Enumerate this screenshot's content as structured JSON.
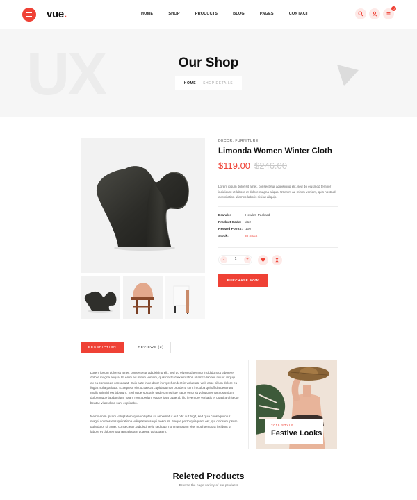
{
  "header": {
    "logo_text": "vue",
    "logo_dot": ".",
    "nav": [
      "HOME",
      "SHOP",
      "PRODUCTS",
      "BLOG",
      "PAGES",
      "CONTACT"
    ],
    "cart_count": "0",
    "icons": [
      "menu-icon",
      "search-icon",
      "user-icon",
      "cart-icon"
    ]
  },
  "hero": {
    "watermark": "UX",
    "title": "Our Shop",
    "breadcrumb_home": "HOME",
    "breadcrumb_sep": "|",
    "breadcrumb_current": "SHOP DETAILS"
  },
  "product": {
    "category": "DECOR, FURNITURE",
    "title": "Limonda Women Winter Cloth",
    "price": "$119.00",
    "old_price": "$246.00",
    "description": "Lorem ipsum dolor sit amet, consectetur adipisicing elit, sed do eiusmod tempor incididunt ut labore et dolore magna aliqua. Ut enim ad minim veniam, quis nostrud exercitation ullamco laboris nisi ut aliquip.",
    "specs": [
      {
        "label": "Brands:",
        "value": "Hewlett-Packard"
      },
      {
        "label": "Product Code:",
        "value": "d12"
      },
      {
        "label": "Reward Points:",
        "value": "100"
      },
      {
        "label": "Stock:",
        "value": "In Stock"
      }
    ],
    "quantity": "1",
    "qty_minus": "-",
    "qty_plus": "+",
    "purchase_label": "PURCHASE NOW"
  },
  "tabs": [
    {
      "label": "DESCRIPTION",
      "active": true
    },
    {
      "label": "REVIEWS (2)",
      "active": false
    }
  ],
  "description_text": {
    "p1": "Lorem ipsum dolor sit amet, consectetur adipisicing elit, sed do eiusmod tempor incididunt ut labore et dolore magna aliqua. Ut enim ad minim veniam, quis nostrud exercitation ullamco laboris nisi ut aliquip ex ea commodo consequat. Duis aute irure dolor in reprehenderit in voluptate velit esse cillum dolore eu fugiat nulla pariatur. Excepteur sint occaecat cupidatat non proident, sunt in culpa qui officia deserunt mollit anim id est laborum. Sed ut perspiciatis unde omnis iste natus error sit voluptatem accusantium doloremque laudantium, totam rem aperiam eaque ipsa quae ab illo inventore veritatis et quasi architecto beatae vitae dicta sunt explicabo.",
    "p2": "Nemo enim ipsam voluptatem quia voluptas sit aspernatur aut odit aut fugit, sed quia consequuntur magni dolores eos qui ratione voluptatem sequi nesciunt. Neque porro quisquam est, qui dolorem ipsum quia dolor sit amet, consectetur, adipisci velit, sed quia non numquam eius modi tempora incidunt ut labore et dolore magnam aliquam quaerat voluptatem."
  },
  "promo": {
    "kicker": "2019 STYLE",
    "title": "Festive Looks"
  },
  "related": {
    "title": "Releted Products",
    "subtitle": "Browse the huge variety of our products"
  },
  "colors": {
    "accent": "#ef4135",
    "accent_light": "#fde9e7",
    "hero_bg": "#f6f6f6"
  }
}
